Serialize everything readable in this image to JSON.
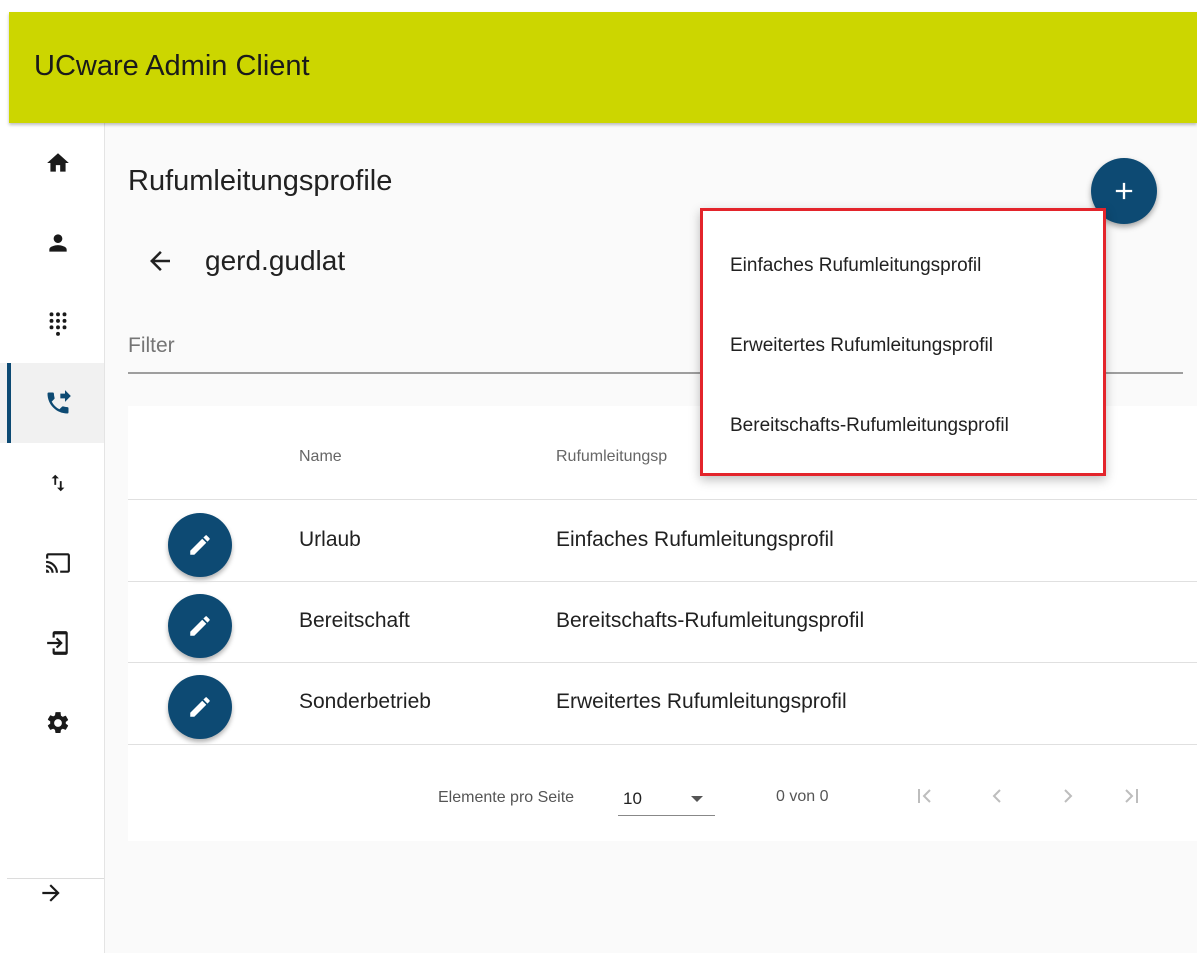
{
  "app": {
    "title": "UCware Admin Client"
  },
  "sidebar": {
    "items": [
      {
        "icon": "home-icon"
      },
      {
        "icon": "person-icon"
      },
      {
        "icon": "dialpad-icon"
      },
      {
        "icon": "phone-forward-icon",
        "active": true
      },
      {
        "icon": "import-export-icon"
      },
      {
        "icon": "cast-icon"
      },
      {
        "icon": "login-icon"
      },
      {
        "icon": "gear-icon"
      }
    ],
    "expand_icon": "arrow-right-icon"
  },
  "page": {
    "title": "Rufumleitungsprofile",
    "user": "gerd.gudlat",
    "filter_placeholder": "Filter"
  },
  "table": {
    "headers": [
      "Name",
      "Rufumleitungsp"
    ],
    "rows": [
      {
        "name": "Urlaub",
        "type": "Einfaches Rufumleitungsprofil"
      },
      {
        "name": "Bereitschaft",
        "type": "Bereitschafts-Rufumleitungsprofil"
      },
      {
        "name": "Sonderbetrieb",
        "type": "Erweitertes Rufumleitungsprofil"
      }
    ]
  },
  "paginator": {
    "label": "Elemente pro Seite",
    "page_size": "10",
    "range": "0 von 0"
  },
  "add_menu": {
    "items": [
      "Einfaches Rufumleitungsprofil",
      "Erweitertes Rufumleitungsprofil",
      "Bereitschafts-Rufumleitungsprofil"
    ]
  },
  "colors": {
    "topbar": "#ccd600",
    "accent": "#0d4a73",
    "highlight_border": "#e3242b"
  }
}
